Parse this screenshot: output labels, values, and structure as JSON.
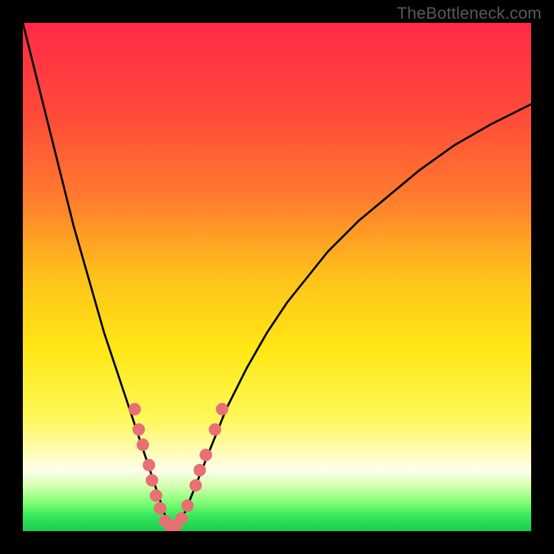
{
  "watermark": "TheBottleneck.com",
  "gradient": {
    "stops": [
      {
        "offset": 0.0,
        "color": "#ff2a46"
      },
      {
        "offset": 0.18,
        "color": "#ff4a3a"
      },
      {
        "offset": 0.34,
        "color": "#ff7a2e"
      },
      {
        "offset": 0.5,
        "color": "#ffc21b"
      },
      {
        "offset": 0.64,
        "color": "#ffe714"
      },
      {
        "offset": 0.78,
        "color": "#fff85a"
      },
      {
        "offset": 0.84,
        "color": "#fffbb0"
      },
      {
        "offset": 0.88,
        "color": "#fdffea"
      },
      {
        "offset": 0.91,
        "color": "#d6ffb2"
      },
      {
        "offset": 0.94,
        "color": "#8bff7a"
      },
      {
        "offset": 0.97,
        "color": "#36e85a"
      },
      {
        "offset": 1.0,
        "color": "#1acb4e"
      }
    ]
  },
  "chart_data": {
    "type": "line",
    "title": "",
    "xlabel": "",
    "ylabel": "",
    "x_range": [
      0,
      100
    ],
    "y_range": [
      0,
      100
    ],
    "legend": null,
    "grid": false,
    "series": [
      {
        "name": "bottleneck-curve",
        "x": [
          0,
          2,
          4,
          6,
          8,
          10,
          12,
          14,
          16,
          18,
          20,
          22,
          24,
          26,
          27,
          28,
          28.5,
          29,
          30,
          31,
          32,
          34,
          36,
          38,
          40,
          44,
          48,
          52,
          56,
          60,
          66,
          72,
          78,
          85,
          92,
          100
        ],
        "y": [
          100,
          92,
          84,
          76,
          68,
          60,
          53,
          46,
          39,
          33,
          27,
          21,
          15,
          9,
          6,
          3,
          1.5,
          1,
          1,
          2,
          4,
          9,
          14,
          19,
          24,
          32,
          39,
          45,
          50,
          55,
          61,
          66,
          71,
          76,
          80,
          84
        ]
      }
    ],
    "markers": {
      "name": "sample-dots",
      "color": "#e86f73",
      "radius_px": 9,
      "points_xy": [
        [
          22.0,
          24
        ],
        [
          22.8,
          20
        ],
        [
          23.6,
          17
        ],
        [
          24.8,
          13
        ],
        [
          25.4,
          10
        ],
        [
          26.2,
          7
        ],
        [
          27.0,
          4.5
        ],
        [
          28.0,
          2
        ],
        [
          29.0,
          1
        ],
        [
          30.0,
          1
        ],
        [
          31.2,
          2.5
        ],
        [
          32.4,
          5
        ],
        [
          34.0,
          9
        ],
        [
          34.8,
          12
        ],
        [
          36.0,
          15
        ],
        [
          37.8,
          20
        ],
        [
          39.2,
          24
        ]
      ]
    }
  }
}
